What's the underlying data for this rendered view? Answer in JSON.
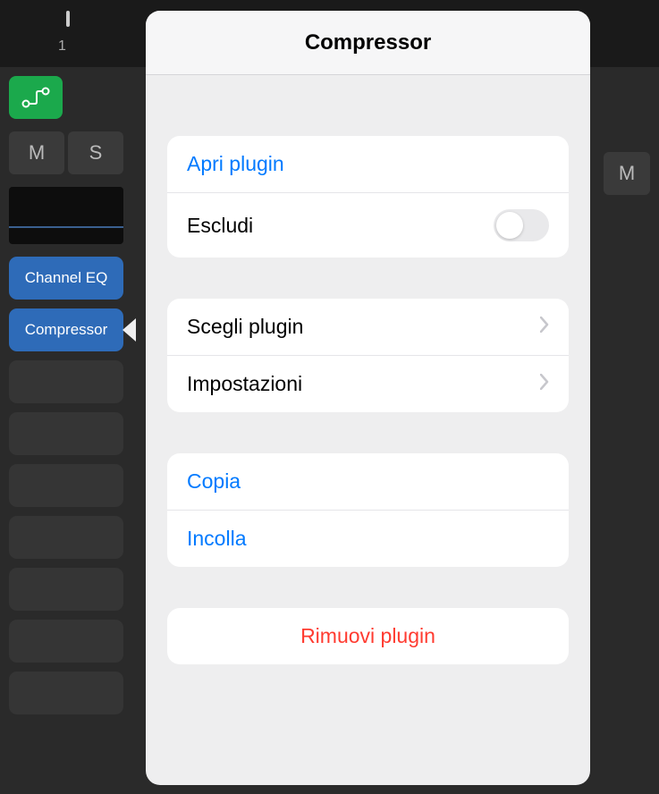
{
  "track": {
    "number": "1"
  },
  "sidebar": {
    "mute_label": "M",
    "solo_label": "S",
    "plugins": [
      {
        "label": "Channel EQ",
        "state": "filled"
      },
      {
        "label": "Compressor",
        "state": "active"
      }
    ]
  },
  "right": {
    "mute_label": "M"
  },
  "popover": {
    "title": "Compressor",
    "group1": {
      "open_plugin": "Apri plugin",
      "bypass_label": "Escludi",
      "bypass_on": false
    },
    "group2": {
      "choose_plugin": "Scegli plugin",
      "settings": "Impostazioni"
    },
    "group3": {
      "copy": "Copia",
      "paste": "Incolla"
    },
    "group4": {
      "remove": "Rimuovi plugin"
    }
  }
}
